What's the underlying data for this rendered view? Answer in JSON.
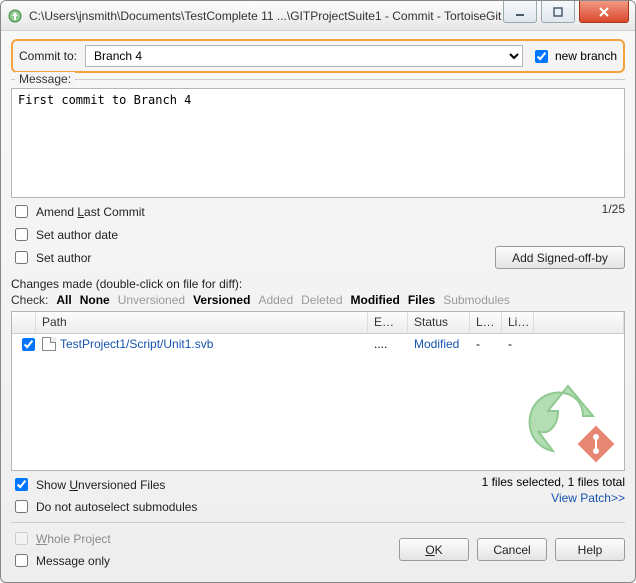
{
  "window": {
    "title": "C:\\Users\\jnsmith\\Documents\\TestComplete 11 ...\\GITProjectSuite1 - Commit - TortoiseGit"
  },
  "commit_to": {
    "label": "Commit to:",
    "value": "Branch 4",
    "new_branch_label": "new branch",
    "new_branch_checked": true
  },
  "message": {
    "label": "Message:",
    "text": "First commit to Branch 4",
    "counter": "1/25"
  },
  "options": {
    "amend": "Amend Last Commit",
    "set_author_date": "Set author date",
    "set_author": "Set author",
    "signed_off": "Add Signed-off-by"
  },
  "changes": {
    "label": "Changes made (double-click on file for diff):",
    "check_label": "Check:",
    "filters": {
      "all": "All",
      "none": "None",
      "unversioned": "Unversioned",
      "versioned": "Versioned",
      "added": "Added",
      "deleted": "Deleted",
      "modified": "Modified",
      "files": "Files",
      "submodules": "Submodules"
    },
    "columns": {
      "path": "Path",
      "ext": "E…",
      "status": "Status",
      "l1": "L…",
      "l2": "Li…"
    },
    "row": {
      "path": "TestProject1/Script/Unit1.svb",
      "ext": "....",
      "status": "Modified",
      "l1": "-",
      "l2": "-",
      "checked": true
    }
  },
  "below_list": {
    "show_unversioned": "Show Unversioned Files",
    "show_unversioned_checked": true,
    "no_autoselect": "Do not autoselect submodules",
    "summary": "1 files selected, 1 files total",
    "view_patch": "View Patch>>"
  },
  "bottom": {
    "whole_project": "Whole Project",
    "message_only": "Message only",
    "ok": "OK",
    "cancel": "Cancel",
    "help": "Help"
  }
}
